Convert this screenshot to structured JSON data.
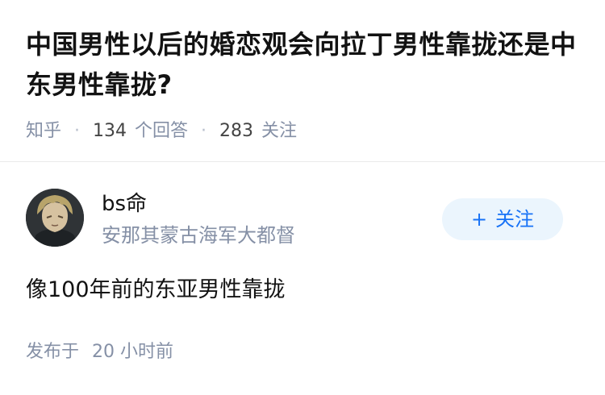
{
  "question": {
    "title": "中国男性以后的婚恋观会向拉丁男性靠拢还是中东男性靠拢?",
    "source": "知乎",
    "answer_count": "134",
    "answer_unit": "个回答",
    "follower_count": "283",
    "follower_unit": "关注"
  },
  "author": {
    "avatar_icon": "avatar-portrait-icon",
    "name": "bs命",
    "bio": "安那其蒙古海军大都督",
    "follow_plus": "+",
    "follow_label": "关注"
  },
  "answer": {
    "content": "像100年前的东亚男性靠拢",
    "published_prefix": "发布于",
    "published_time": "20 小时前"
  },
  "colors": {
    "text_primary": "#121212",
    "text_secondary": "#8590a6",
    "accent": "#1772f6",
    "follow_bg": "#ebf5fd",
    "divider": "#ebebeb"
  }
}
